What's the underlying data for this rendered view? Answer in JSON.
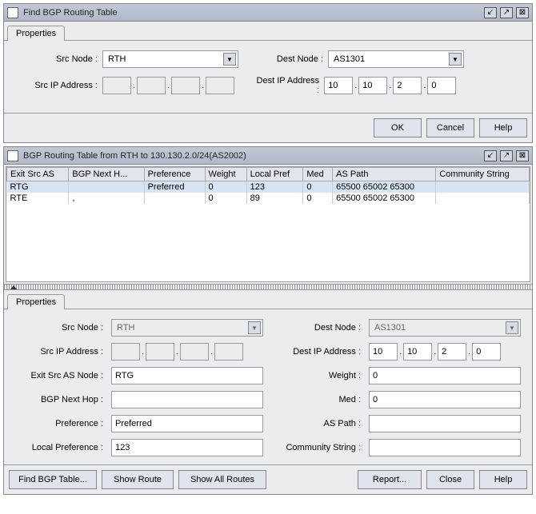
{
  "win1": {
    "title": "Find BGP Routing Table",
    "tab": "Properties",
    "labels": {
      "src_node": "Src Node :",
      "dest_node": "Dest Node :",
      "src_ip": "Src IP Address :",
      "dest_ip": "Dest IP Address :"
    },
    "src_node_value": "RTH",
    "dest_node_value": "AS1301",
    "src_ip": [
      "",
      "",
      "",
      ""
    ],
    "dest_ip": [
      "10",
      "10",
      "2",
      "0"
    ],
    "buttons": {
      "ok": "OK",
      "cancel": "Cancel",
      "help": "Help"
    }
  },
  "win2": {
    "title": "BGP Routing Table from RTH to 130.130.2.0/24(AS2002)",
    "table": {
      "headers": [
        "Exit Src AS",
        "BGP Next H...",
        "Preference",
        "Weight",
        "Local Pref",
        "Med",
        "AS Path",
        "Community String"
      ],
      "rows": [
        {
          "selected": true,
          "cells": [
            "RTG",
            "",
            "Preferred",
            "0",
            "123",
            "0",
            "65500 65002 65300",
            ""
          ]
        },
        {
          "selected": false,
          "cells": [
            "RTE",
            ",",
            "",
            "0",
            "89",
            "0",
            "65500 65002 65300",
            ""
          ]
        }
      ]
    },
    "tab": "Properties",
    "labels": {
      "src_node": "Src Node :",
      "dest_node": "Dest Node :",
      "src_ip": "Src IP Address :",
      "dest_ip": "Dest IP Address :",
      "exit_src": "Exit Src AS Node :",
      "weight": "Weight :",
      "bgp_next": "BGP Next Hop :",
      "med": "Med :",
      "preference": "Preference :",
      "as_path": "AS Path :",
      "local_pref": "Local Preference :",
      "community": "Community String :"
    },
    "props": {
      "src_node": "RTH",
      "dest_node": "AS1301",
      "src_ip": [
        "",
        "",
        "",
        ""
      ],
      "dest_ip": [
        "10",
        "10",
        "2",
        "0"
      ],
      "exit_src": "RTG",
      "weight": "0",
      "bgp_next": "",
      "med": "0",
      "preference": "Preferred",
      "as_path": "",
      "local_pref": "123",
      "community": ""
    },
    "buttons": {
      "find": "Find BGP Table...",
      "show_route": "Show Route",
      "show_all": "Show All Routes",
      "report": "Report...",
      "close": "Close",
      "help": "Help"
    }
  }
}
